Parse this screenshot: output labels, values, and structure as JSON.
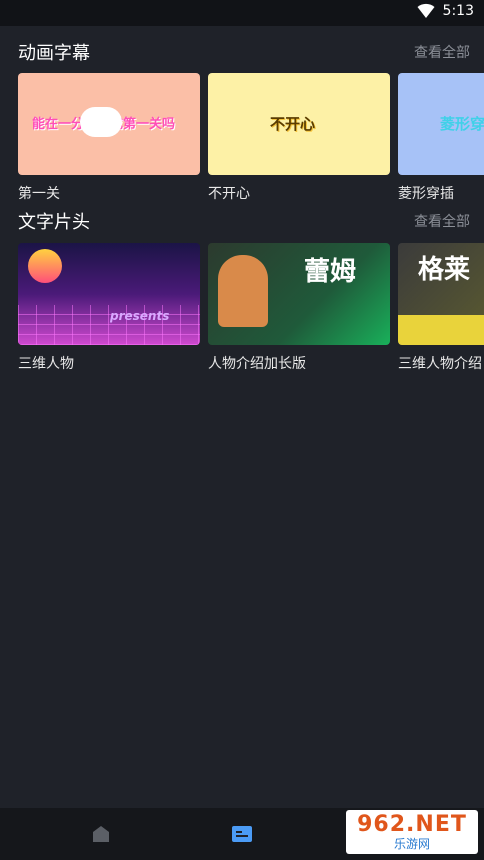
{
  "status_bar": {
    "time": "5:13"
  },
  "sections": [
    {
      "title": "动画字幕",
      "see_all": "查看全部",
      "cards": [
        {
          "label": "第一关",
          "thumb_text": "能在一分钟完成第一关吗",
          "bg": "#fbbfa7"
        },
        {
          "label": "不开心",
          "thumb_text": "不开心",
          "bg": "#fdf1a6"
        },
        {
          "label": "菱形穿插",
          "thumb_text": "菱形穿",
          "bg": "#a7c2f7"
        }
      ]
    },
    {
      "title": "文字片头",
      "see_all": "查看全部",
      "cards": [
        {
          "label": "三维人物",
          "thumb_text": "presents"
        },
        {
          "label": "人物介绍加长版",
          "thumb_text": "蕾姆"
        },
        {
          "label": "三维人物介绍",
          "thumb_text": "格莱"
        }
      ]
    }
  ],
  "bottom_nav": [
    {
      "icon": "home-icon"
    },
    {
      "icon": "template-icon"
    },
    {
      "icon": "folder-icon"
    }
  ],
  "watermark": {
    "top": "962.NET",
    "bottom": "乐游网"
  },
  "colors": {
    "background": "#1f2229",
    "accent": "#4b9bf5",
    "muted": "#8b8f97"
  }
}
